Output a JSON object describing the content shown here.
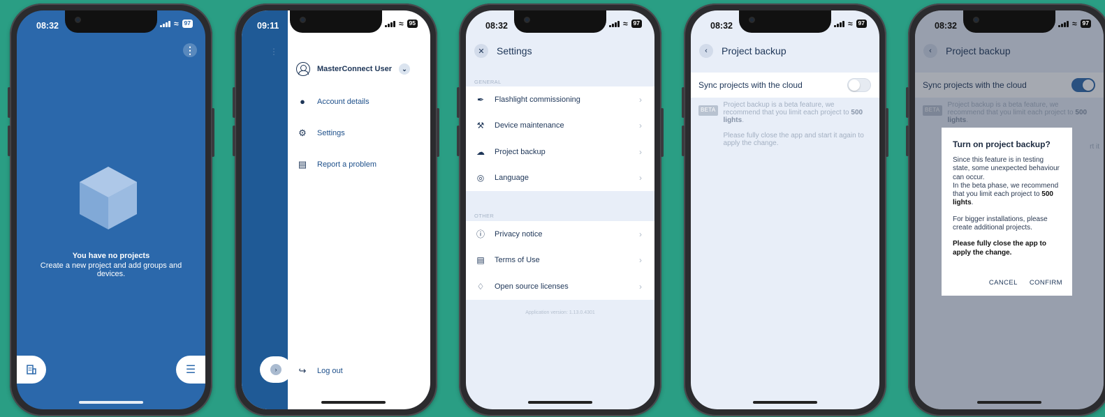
{
  "colors": {
    "background": "#2a9e84",
    "brand_blue": "#2b68ab",
    "text_navy": "#1d3557"
  },
  "phone1": {
    "status": {
      "time": "08:32",
      "battery": "97"
    },
    "empty_title": "You have no projects",
    "empty_subtitle": "Create a new project and add groups and devices.",
    "icons": [
      "kebab-menu-icon",
      "cube-icon",
      "building-icon",
      "hamburger-menu-icon"
    ]
  },
  "phone2": {
    "status": {
      "time": "09:11",
      "battery": "95"
    },
    "user_name": "MasterConnect User",
    "menu": [
      {
        "label": "Account details",
        "icon": "account-icon"
      },
      {
        "label": "Settings",
        "icon": "gear-icon"
      },
      {
        "label": "Report a problem",
        "icon": "feedback-icon"
      }
    ],
    "logout_label": "Log out"
  },
  "phone3": {
    "status": {
      "time": "08:32",
      "battery": "97"
    },
    "title": "Settings",
    "general_label": "GENERAL",
    "general_items": [
      {
        "label": "Flashlight commissioning",
        "icon": "flashlight-icon"
      },
      {
        "label": "Device maintenance",
        "icon": "wrench-icon"
      },
      {
        "label": "Project backup",
        "icon": "cloud-icon"
      },
      {
        "label": "Language",
        "icon": "globe-icon"
      }
    ],
    "other_label": "OTHER",
    "other_items": [
      {
        "label": "Privacy notice",
        "icon": "info-icon"
      },
      {
        "label": "Terms of Use",
        "icon": "document-icon"
      },
      {
        "label": "Open source licenses",
        "icon": "license-icon"
      }
    ],
    "version": "Application version: 1.13.0.4301"
  },
  "phone4": {
    "status": {
      "time": "08:32",
      "battery": "97"
    },
    "title": "Project backup",
    "sync_label": "Sync projects with the cloud",
    "sync_enabled": false,
    "beta_badge": "BETA",
    "beta_text_pre": "Project backup is a beta feature, we recommend that you limit each project to ",
    "beta_text_bold": "500 lights",
    "beta_text_post": ".",
    "restart_note": "Please fully close the app and start it again to apply the change."
  },
  "phone5": {
    "status": {
      "time": "08:32",
      "battery": "97"
    },
    "title": "Project backup",
    "sync_label": "Sync projects with the cloud",
    "sync_enabled": true,
    "beta_badge": "BETA",
    "beta_text_pre": "Project backup is a beta feature, we recommend that you limit each project to ",
    "beta_text_bold": "500 lights",
    "beta_text_post": ".",
    "ghost_text": "rt it",
    "dialog": {
      "title": "Turn on project backup?",
      "p1": "Since this feature is in testing state, some unexpected behaviour can occur.",
      "p1b_pre": "In the beta phase, we recommend that you limit each project to ",
      "p1b_bold": "500 lights",
      "p1b_post": ".",
      "p2": "For bigger installations, please create additional projects.",
      "p3": "Please fully close the app to apply the change.",
      "cancel": "CANCEL",
      "confirm": "CONFIRM"
    }
  }
}
